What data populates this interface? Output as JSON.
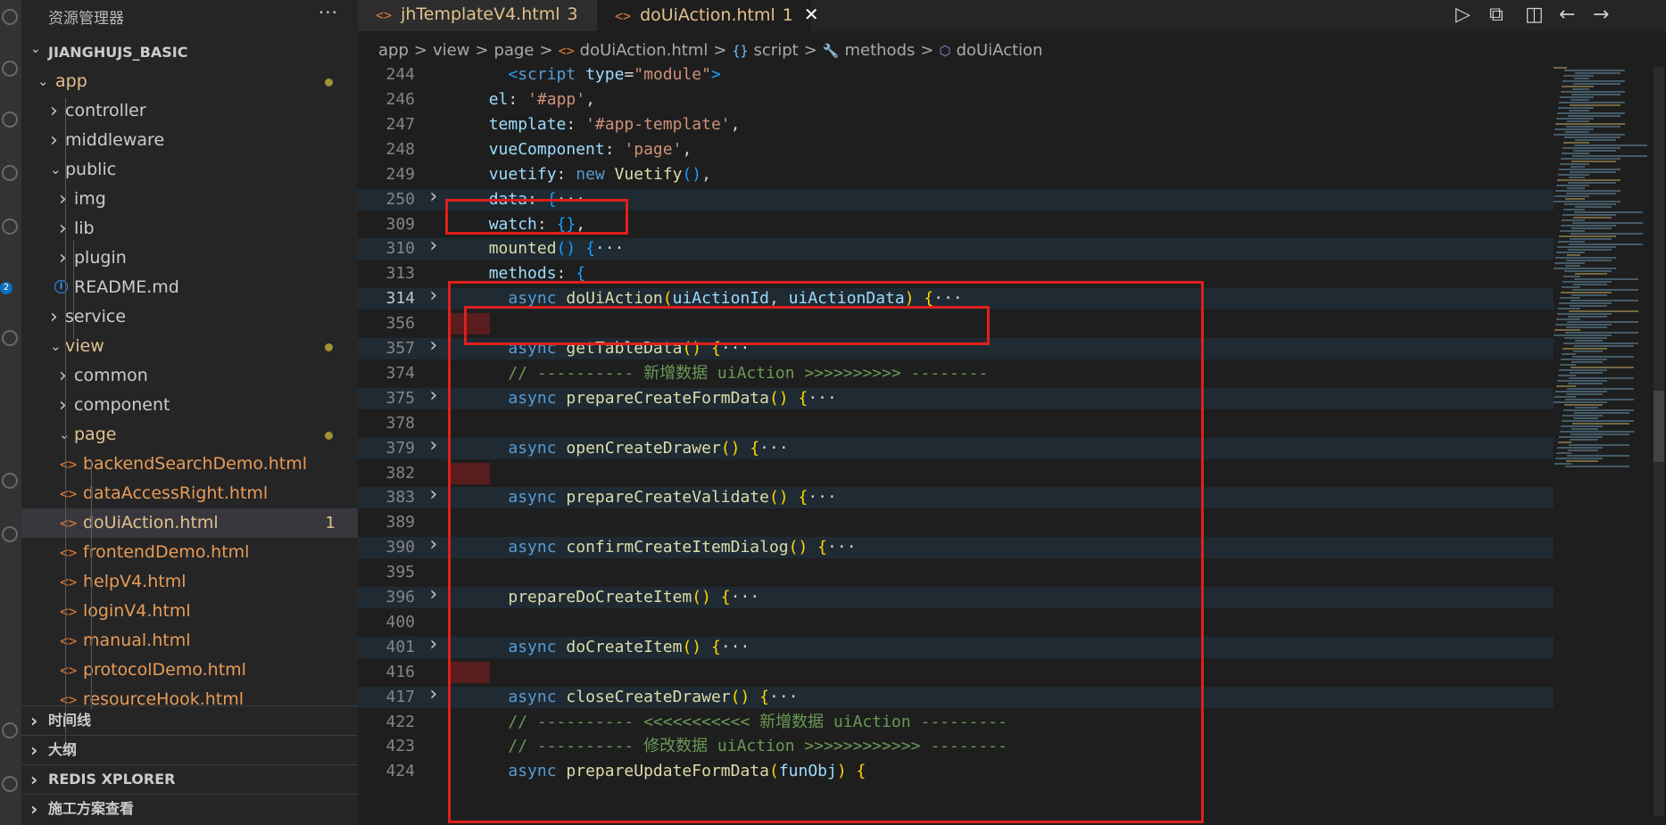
{
  "explorer": {
    "title": "资源管理器",
    "more": "···",
    "root": "JIANGHUJS_BASIC",
    "tree": [
      {
        "label": "app",
        "type": "folder",
        "open": true,
        "depth": 1,
        "modified": true
      },
      {
        "label": "controller",
        "type": "folder",
        "open": false,
        "depth": 2
      },
      {
        "label": "middleware",
        "type": "folder",
        "open": false,
        "depth": 2
      },
      {
        "label": "public",
        "type": "folder",
        "open": true,
        "depth": 2
      },
      {
        "label": "img",
        "type": "folder",
        "open": false,
        "depth": 3
      },
      {
        "label": "lib",
        "type": "folder",
        "open": false,
        "depth": 3
      },
      {
        "label": "plugin",
        "type": "folder",
        "open": false,
        "depth": 3
      },
      {
        "label": "README.md",
        "type": "info",
        "depth": 3
      },
      {
        "label": "service",
        "type": "folder",
        "open": false,
        "depth": 2
      },
      {
        "label": "view",
        "type": "folder",
        "open": true,
        "depth": 2,
        "modified": true
      },
      {
        "label": "common",
        "type": "folder",
        "open": false,
        "depth": 3
      },
      {
        "label": "component",
        "type": "folder",
        "open": false,
        "depth": 3
      },
      {
        "label": "page",
        "type": "folder",
        "open": true,
        "depth": 3,
        "modified": true
      },
      {
        "label": "backendSearchDemo.html",
        "type": "html",
        "depth": 4
      },
      {
        "label": "dataAccessRight.html",
        "type": "html",
        "depth": 4
      },
      {
        "label": "doUiAction.html",
        "type": "html",
        "depth": 4,
        "selected": true,
        "count": "1"
      },
      {
        "label": "frontendDemo.html",
        "type": "html",
        "depth": 4
      },
      {
        "label": "helpV4.html",
        "type": "html",
        "depth": 4
      },
      {
        "label": "loginV4.html",
        "type": "html",
        "depth": 4
      },
      {
        "label": "manual.html",
        "type": "html",
        "depth": 4
      },
      {
        "label": "protocolDemo.html",
        "type": "html",
        "depth": 4
      },
      {
        "label": "resourceHook.html",
        "type": "html",
        "depth": 4
      }
    ],
    "sections": [
      "时间线",
      "大纲",
      "REDIS XPLORER",
      "施工方案查看"
    ]
  },
  "activity": {
    "badge": "2"
  },
  "tabs": [
    {
      "icon": "<>",
      "label": "jhTemplateV4.html",
      "badge": "3",
      "active": false
    },
    {
      "icon": "<>",
      "label": "doUiAction.html",
      "badge": "1",
      "active": true,
      "close": "✕"
    }
  ],
  "toolbar": [
    {
      "name": "run-icon",
      "glyph": "▷"
    },
    {
      "name": "compare-icon",
      "glyph": "⧉"
    },
    {
      "name": "split-editor-icon",
      "glyph": "◫"
    },
    {
      "name": "go-back-icon",
      "glyph": "←"
    },
    {
      "name": "go-forward-icon",
      "glyph": "→"
    },
    {
      "name": "more-actions-icon",
      "glyph": "⋯"
    }
  ],
  "breadcrumb": {
    "items": [
      "app",
      "view",
      "page",
      "doUiAction.html",
      "script",
      "methods",
      "doUiAction"
    ],
    "sep": ">",
    "file_icon": "<>",
    "script_icon": "{}",
    "methods_icon": "🔧",
    "cube_icon": "⬡"
  },
  "code": [
    {
      "n": "244",
      "segs": [
        [
          "plain",
          "    "
        ],
        [
          "br3",
          "<"
        ],
        [
          "kw",
          "script"
        ],
        [
          "plain",
          " "
        ],
        [
          "prop",
          "type"
        ],
        [
          "plain",
          "="
        ],
        [
          "str",
          "\"module\""
        ],
        [
          "br3",
          ">"
        ]
      ]
    },
    {
      "n": "246",
      "segs": [
        [
          "plain",
          "  "
        ],
        [
          "prop",
          "el"
        ],
        [
          "plain",
          ": "
        ],
        [
          "str",
          "'#app'"
        ],
        [
          "plain",
          ","
        ]
      ]
    },
    {
      "n": "247",
      "segs": [
        [
          "plain",
          "  "
        ],
        [
          "prop",
          "template"
        ],
        [
          "plain",
          ": "
        ],
        [
          "str",
          "'#app-template'"
        ],
        [
          "plain",
          ","
        ]
      ]
    },
    {
      "n": "248",
      "segs": [
        [
          "plain",
          "  "
        ],
        [
          "prop",
          "vueComponent"
        ],
        [
          "plain",
          ": "
        ],
        [
          "str",
          "'page'"
        ],
        [
          "plain",
          ","
        ]
      ]
    },
    {
      "n": "249",
      "segs": [
        [
          "plain",
          "  "
        ],
        [
          "prop",
          "vuetify"
        ],
        [
          "plain",
          ": "
        ],
        [
          "kw",
          "new"
        ],
        [
          "plain",
          " "
        ],
        [
          "fn",
          "Vuetify"
        ],
        [
          "br3",
          "()"
        ],
        [
          "plain",
          ","
        ]
      ]
    },
    {
      "n": "250",
      "fold": true,
      "hl": true,
      "segs": [
        [
          "plain",
          "  "
        ],
        [
          "prop",
          "data"
        ],
        [
          "plain",
          ": "
        ],
        [
          "br3",
          "{"
        ],
        [
          "ell",
          "···"
        ]
      ]
    },
    {
      "n": "309",
      "segs": [
        [
          "plain",
          "  "
        ],
        [
          "prop",
          "watch"
        ],
        [
          "plain",
          ": "
        ],
        [
          "br3",
          "{}"
        ],
        [
          "plain",
          ","
        ]
      ]
    },
    {
      "n": "310",
      "fold": true,
      "hl": true,
      "segs": [
        [
          "plain",
          "  "
        ],
        [
          "fn",
          "mounted"
        ],
        [
          "br3",
          "()"
        ],
        [
          "plain",
          " "
        ],
        [
          "br3",
          "{"
        ],
        [
          "ell",
          "···"
        ]
      ]
    },
    {
      "n": "313",
      "segs": [
        [
          "plain",
          "  "
        ],
        [
          "prop",
          "methods"
        ],
        [
          "plain",
          ": "
        ],
        [
          "br3",
          "{"
        ]
      ]
    },
    {
      "n": "314",
      "fold": true,
      "hl": true,
      "active": true,
      "segs": [
        [
          "plain",
          "    "
        ],
        [
          "kw",
          "async"
        ],
        [
          "plain",
          " "
        ],
        [
          "fn",
          "doUiAction"
        ],
        [
          "br1",
          "("
        ],
        [
          "prop",
          "uiActionId"
        ],
        [
          "plain",
          ", "
        ],
        [
          "prop",
          "uiActionData"
        ],
        [
          "br1",
          ")"
        ],
        [
          "plain",
          " "
        ],
        [
          "br1",
          "{"
        ],
        [
          "ell",
          "···"
        ]
      ]
    },
    {
      "n": "356",
      "marker": true,
      "segs": []
    },
    {
      "n": "357",
      "fold": true,
      "hl": true,
      "segs": [
        [
          "plain",
          "    "
        ],
        [
          "kw",
          "async"
        ],
        [
          "plain",
          " "
        ],
        [
          "fn",
          "getTableData"
        ],
        [
          "br1",
          "()"
        ],
        [
          "plain",
          " "
        ],
        [
          "br1",
          "{"
        ],
        [
          "ell",
          "···"
        ]
      ]
    },
    {
      "n": "374",
      "segs": [
        [
          "plain",
          "    "
        ],
        [
          "cmt",
          "// ---------- 新增数据 uiAction >>>>>>>>>> --------"
        ]
      ]
    },
    {
      "n": "375",
      "fold": true,
      "hl": true,
      "segs": [
        [
          "plain",
          "    "
        ],
        [
          "kw",
          "async"
        ],
        [
          "plain",
          " "
        ],
        [
          "fn",
          "prepareCreateFormData"
        ],
        [
          "br1",
          "()"
        ],
        [
          "plain",
          " "
        ],
        [
          "br1",
          "{"
        ],
        [
          "ell",
          "···"
        ]
      ]
    },
    {
      "n": "378",
      "segs": []
    },
    {
      "n": "379",
      "fold": true,
      "hl": true,
      "segs": [
        [
          "plain",
          "    "
        ],
        [
          "kw",
          "async"
        ],
        [
          "plain",
          " "
        ],
        [
          "fn",
          "openCreateDrawer"
        ],
        [
          "br1",
          "()"
        ],
        [
          "plain",
          " "
        ],
        [
          "br1",
          "{"
        ],
        [
          "ell",
          "···"
        ]
      ]
    },
    {
      "n": "382",
      "marker": true,
      "segs": []
    },
    {
      "n": "383",
      "fold": true,
      "hl": true,
      "segs": [
        [
          "plain",
          "    "
        ],
        [
          "kw",
          "async"
        ],
        [
          "plain",
          " "
        ],
        [
          "fn",
          "prepareCreateValidate"
        ],
        [
          "br1",
          "()"
        ],
        [
          "plain",
          " "
        ],
        [
          "br1",
          "{"
        ],
        [
          "ell",
          "···"
        ]
      ]
    },
    {
      "n": "389",
      "segs": []
    },
    {
      "n": "390",
      "fold": true,
      "hl": true,
      "segs": [
        [
          "plain",
          "    "
        ],
        [
          "kw",
          "async"
        ],
        [
          "plain",
          " "
        ],
        [
          "fn",
          "confirmCreateItemDialog"
        ],
        [
          "br1",
          "()"
        ],
        [
          "plain",
          " "
        ],
        [
          "br1",
          "{"
        ],
        [
          "ell",
          "···"
        ]
      ]
    },
    {
      "n": "395",
      "segs": []
    },
    {
      "n": "396",
      "fold": true,
      "hl": true,
      "segs": [
        [
          "plain",
          "    "
        ],
        [
          "fn",
          "prepareDoCreateItem"
        ],
        [
          "br1",
          "()"
        ],
        [
          "plain",
          " "
        ],
        [
          "br1",
          "{"
        ],
        [
          "ell",
          "···"
        ]
      ]
    },
    {
      "n": "400",
      "segs": []
    },
    {
      "n": "401",
      "fold": true,
      "hl": true,
      "segs": [
        [
          "plain",
          "    "
        ],
        [
          "kw",
          "async"
        ],
        [
          "plain",
          " "
        ],
        [
          "fn",
          "doCreateItem"
        ],
        [
          "br1",
          "()"
        ],
        [
          "plain",
          " "
        ],
        [
          "br1",
          "{"
        ],
        [
          "ell",
          "···"
        ]
      ]
    },
    {
      "n": "416",
      "marker": true,
      "segs": []
    },
    {
      "n": "417",
      "fold": true,
      "hl": true,
      "segs": [
        [
          "plain",
          "    "
        ],
        [
          "kw",
          "async"
        ],
        [
          "plain",
          " "
        ],
        [
          "fn",
          "closeCreateDrawer"
        ],
        [
          "br1",
          "()"
        ],
        [
          "plain",
          " "
        ],
        [
          "br1",
          "{"
        ],
        [
          "ell",
          "···"
        ]
      ]
    },
    {
      "n": "422",
      "segs": [
        [
          "plain",
          "    "
        ],
        [
          "cmt",
          "// ---------- <<<<<<<<<<< 新增数据 uiAction ---------"
        ]
      ]
    },
    {
      "n": "423",
      "segs": [
        [
          "plain",
          "    "
        ],
        [
          "cmt",
          "// ---------- 修改数据 uiAction >>>>>>>>>>>> --------"
        ]
      ]
    },
    {
      "n": "424",
      "segs": [
        [
          "plain",
          "    "
        ],
        [
          "kw",
          "async"
        ],
        [
          "plain",
          " "
        ],
        [
          "fn",
          "prepareUpdateFormData"
        ],
        [
          "br1",
          "("
        ],
        [
          "prop",
          "funObj"
        ],
        [
          "br1",
          ")"
        ],
        [
          "plain",
          " "
        ],
        [
          "br1",
          "{"
        ]
      ]
    }
  ],
  "colors": {
    "annotation_red": "#e0201c",
    "accent": "#0e70c0"
  }
}
